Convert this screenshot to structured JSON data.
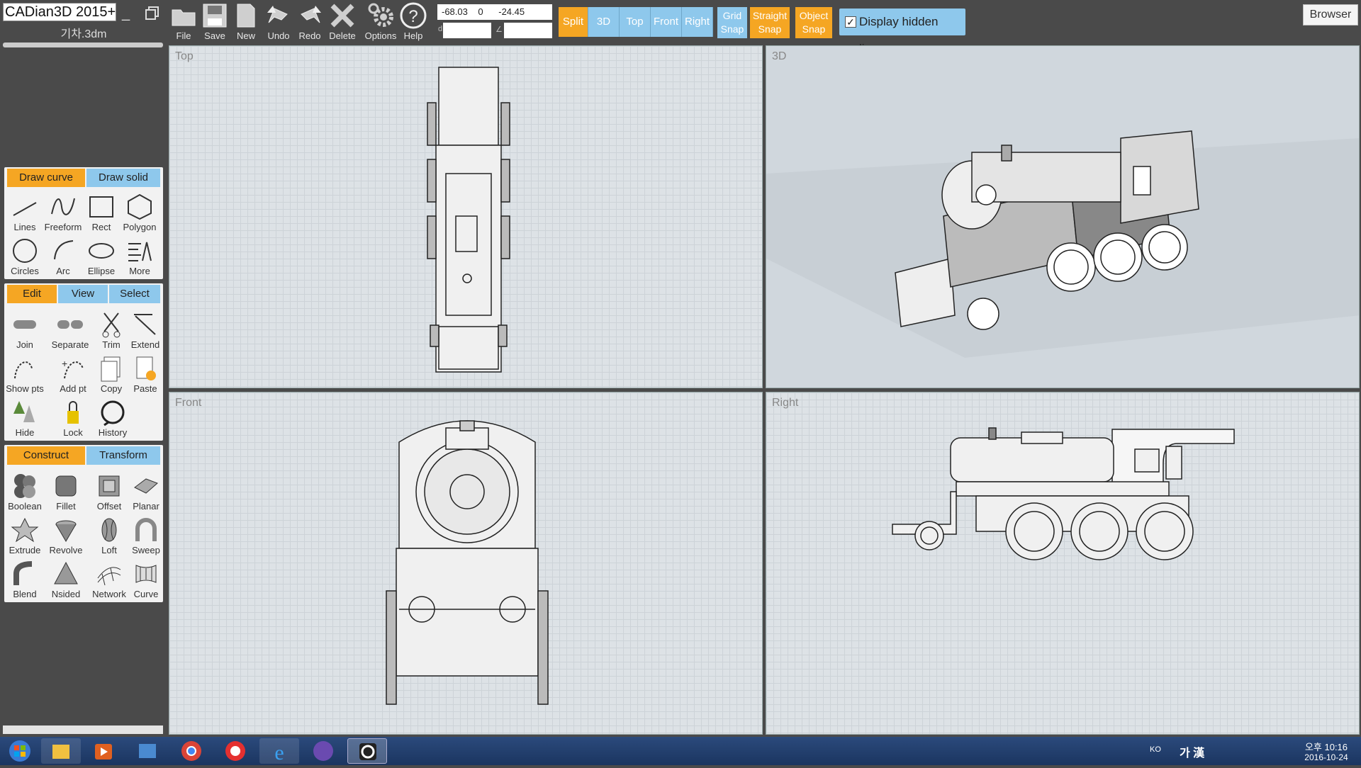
{
  "app": {
    "title": "CADian3D 2015+",
    "file_name": "기차.3dm",
    "minimize_label": "_"
  },
  "toolbar": {
    "buttons": [
      {
        "label": "File",
        "icon": "folder-icon"
      },
      {
        "label": "Save",
        "icon": "save-icon"
      },
      {
        "label": "New",
        "icon": "new-file-icon"
      },
      {
        "label": "Undo",
        "icon": "undo-icon"
      },
      {
        "label": "Redo",
        "icon": "redo-icon"
      },
      {
        "label": "Delete",
        "icon": "delete-icon"
      },
      {
        "label": "Options",
        "icon": "gear-icon"
      },
      {
        "label": "Help",
        "icon": "help-icon"
      }
    ],
    "coords": {
      "x": "-68.03",
      "y": "0",
      "z": "-24.45"
    },
    "small_label_d": "d",
    "small_label_a": "∠",
    "views": [
      "Split",
      "3D",
      "Top",
      "Front",
      "Right"
    ],
    "active_view": "Split",
    "snaps": [
      {
        "line1": "Grid",
        "line2": "Snap",
        "active": false
      },
      {
        "line1": "Straight",
        "line2": "Snap",
        "active": true
      },
      {
        "line1": "Object",
        "line2": "Snap",
        "active": true
      }
    ],
    "hidden_lines_label": "Display hidden lines",
    "hidden_lines_checked": "✓",
    "browser_label": "Browser"
  },
  "panels": {
    "draw": {
      "tabs": [
        "Draw curve",
        "Draw solid"
      ],
      "tools": [
        {
          "label": "Lines",
          "icon": "lines-icon"
        },
        {
          "label": "Freeform",
          "icon": "freeform-icon"
        },
        {
          "label": "Rect",
          "icon": "rect-icon"
        },
        {
          "label": "Polygon",
          "icon": "polygon-icon"
        },
        {
          "label": "Circles",
          "icon": "circle-icon"
        },
        {
          "label": "Arc",
          "icon": "arc-icon"
        },
        {
          "label": "Ellipse",
          "icon": "ellipse-icon"
        },
        {
          "label": "More",
          "icon": "more-icon"
        }
      ]
    },
    "edit": {
      "tabs": [
        "Edit",
        "View",
        "Select"
      ],
      "tools": [
        {
          "label": "Join",
          "icon": "join-icon"
        },
        {
          "label": "Separate",
          "icon": "separate-icon"
        },
        {
          "label": "Trim",
          "icon": "trim-icon"
        },
        {
          "label": "Extend",
          "icon": "extend-icon"
        },
        {
          "label": "Show pts",
          "icon": "show-points-icon"
        },
        {
          "label": "Add pt",
          "icon": "add-point-icon"
        },
        {
          "label": "Copy",
          "icon": "copy-icon"
        },
        {
          "label": "Paste",
          "icon": "paste-icon"
        },
        {
          "label": "Hide",
          "icon": "hide-icon"
        },
        {
          "label": "Lock",
          "icon": "lock-icon"
        },
        {
          "label": "History",
          "icon": "history-icon"
        }
      ]
    },
    "construct": {
      "tabs": [
        "Construct",
        "Transform"
      ],
      "tools": [
        {
          "label": "Boolean",
          "icon": "boolean-icon"
        },
        {
          "label": "Fillet",
          "icon": "fillet-icon"
        },
        {
          "label": "Offset",
          "icon": "offset-icon"
        },
        {
          "label": "Planar",
          "icon": "planar-icon"
        },
        {
          "label": "Extrude",
          "icon": "extrude-icon"
        },
        {
          "label": "Revolve",
          "icon": "revolve-icon"
        },
        {
          "label": "Loft",
          "icon": "loft-icon"
        },
        {
          "label": "Sweep",
          "icon": "sweep-icon"
        },
        {
          "label": "Blend",
          "icon": "blend-icon"
        },
        {
          "label": "Nsided",
          "icon": "nsided-icon"
        },
        {
          "label": "Network",
          "icon": "network-icon"
        },
        {
          "label": "Curve",
          "icon": "curve-icon"
        }
      ]
    }
  },
  "viewports": {
    "top": "Top",
    "perspective": "3D",
    "front": "Front",
    "right": "Right"
  },
  "taskbar": {
    "apps": [
      "start-icon",
      "explorer-icon",
      "media-player-icon",
      "network-app-icon",
      "chrome-icon",
      "app-icon",
      "internet-explorer-icon",
      "s-app-icon",
      "cadian-icon"
    ],
    "lang": "KO",
    "ime": "가 漢",
    "time": "오후 10:16",
    "date": "2016-10-24"
  },
  "colors": {
    "accent_orange": "#f5a623",
    "accent_blue": "#8ec8ec",
    "background": "#4a4a4a",
    "viewport": "#dde2e6"
  }
}
